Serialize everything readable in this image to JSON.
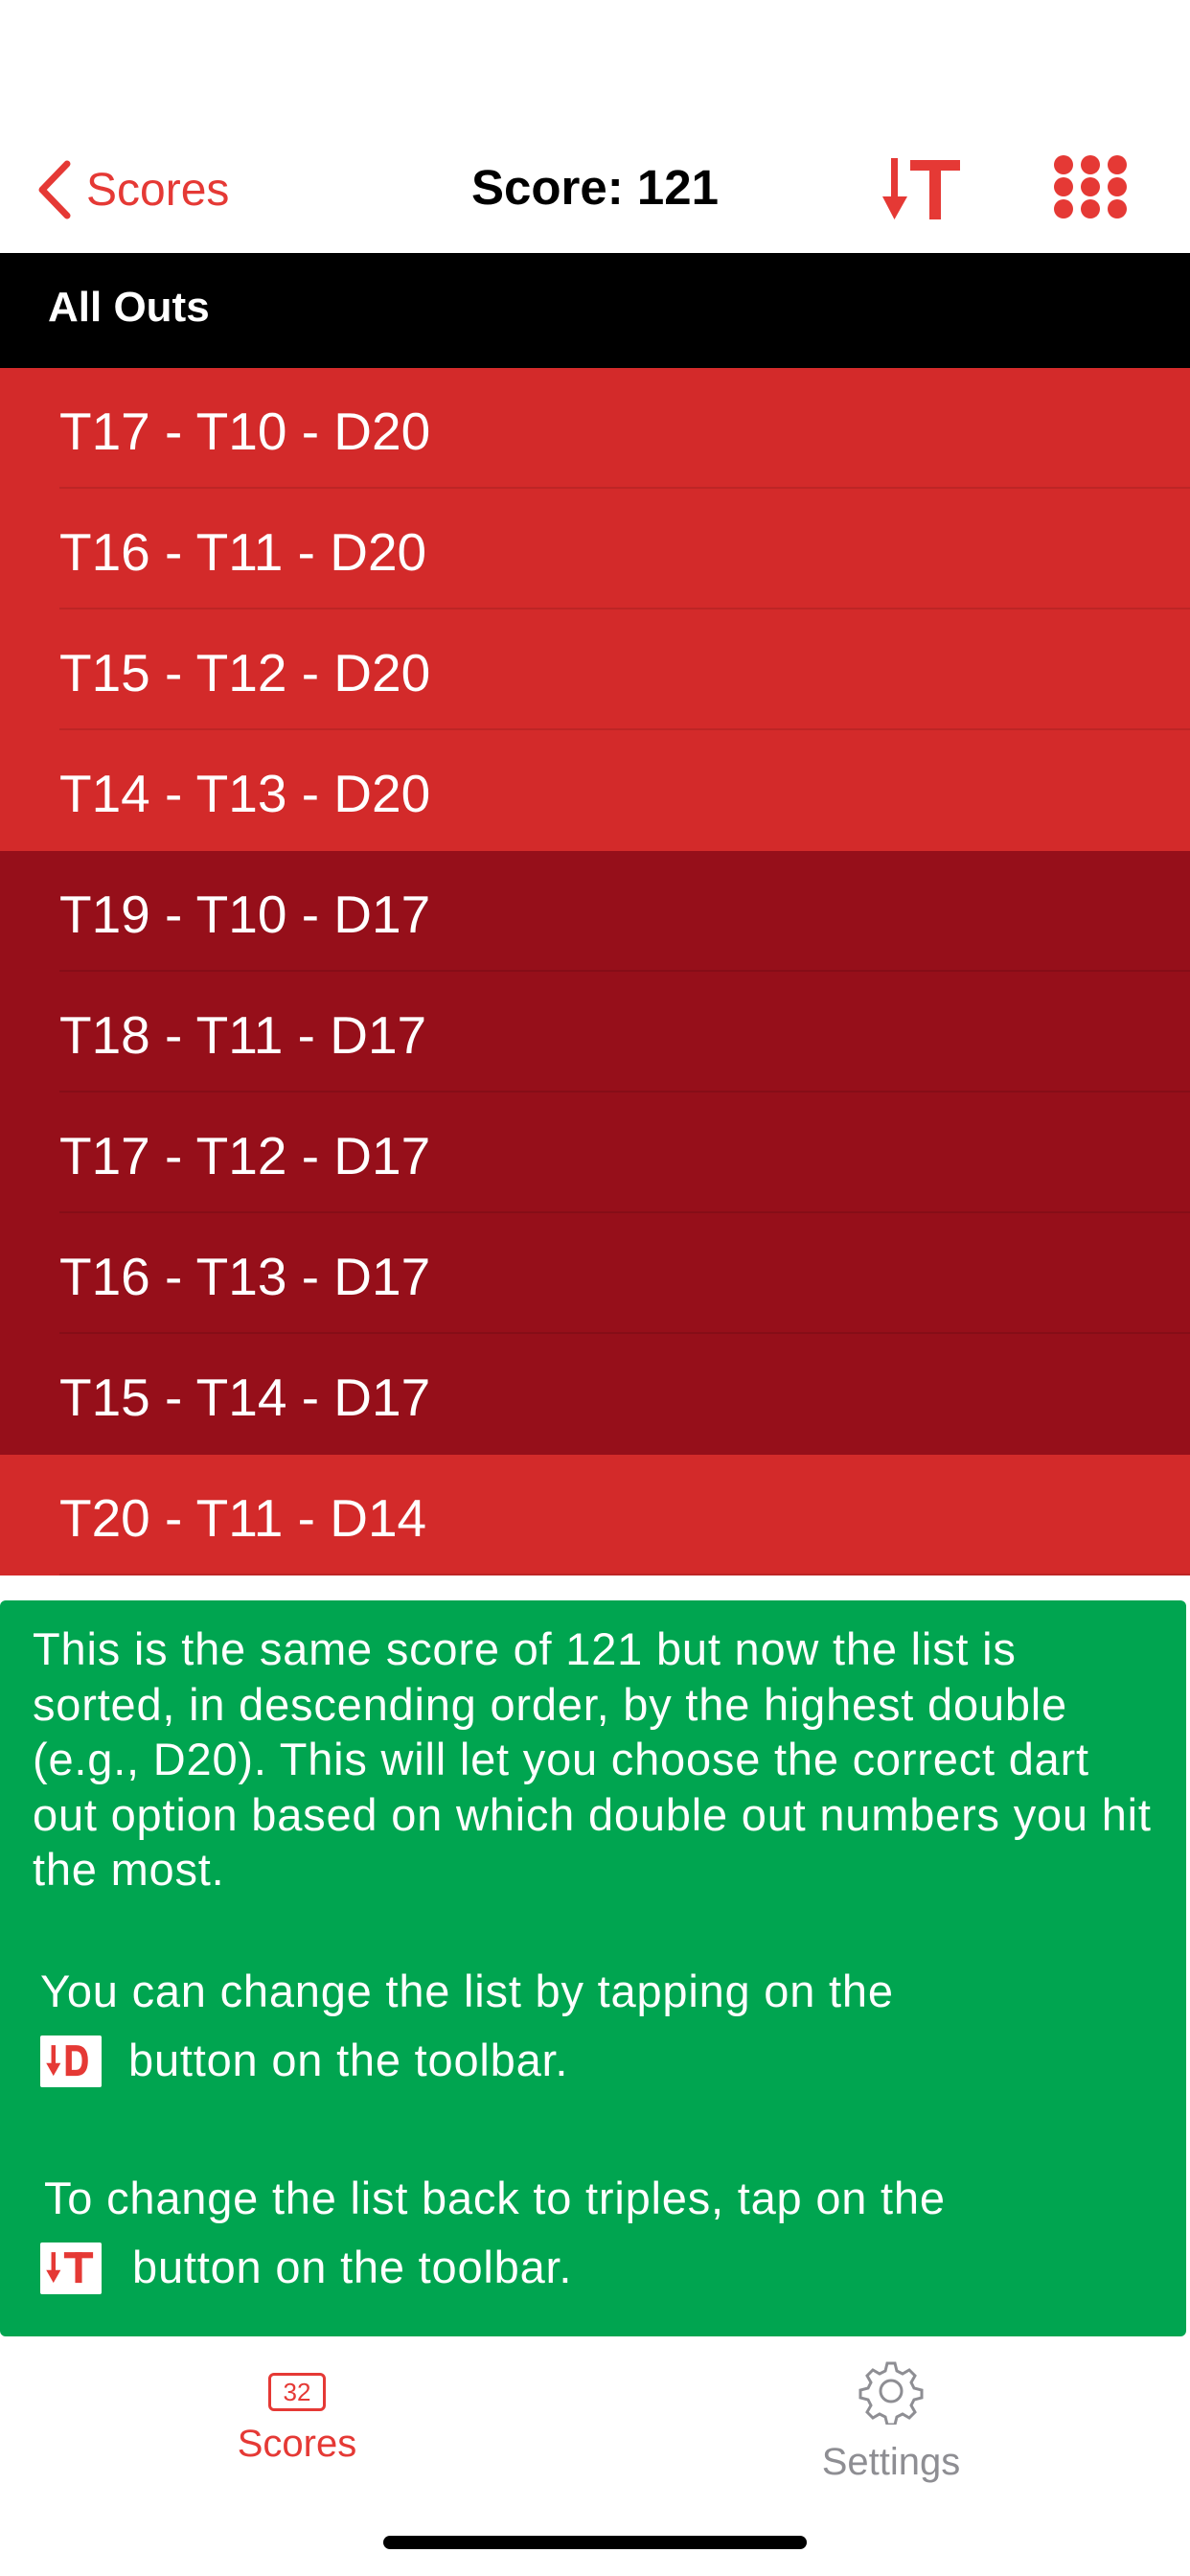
{
  "nav": {
    "back_label": "Scores",
    "title": "Score: 121",
    "sort_icon": "sort-triples-icon",
    "grid_icon": "keypad-grid-icon",
    "accent": "#e53935"
  },
  "section": {
    "header": "All Outs"
  },
  "rows": [
    {
      "label": "T17 - T10 - D20",
      "shade": "light"
    },
    {
      "label": "T16 - T11 - D20",
      "shade": "light"
    },
    {
      "label": "T15 - T12 - D20",
      "shade": "light"
    },
    {
      "label": "T14 - T13 - D20",
      "shade": "light"
    },
    {
      "label": "T19 - T10 - D17",
      "shade": "dark"
    },
    {
      "label": "T18 - T11 - D17",
      "shade": "dark"
    },
    {
      "label": "T17 - T12 - D17",
      "shade": "dark"
    },
    {
      "label": "T16 - T13 - D17",
      "shade": "dark"
    },
    {
      "label": "T15 - T14 - D17",
      "shade": "dark"
    },
    {
      "label": "T20 - T11 - D14",
      "shade": "light"
    }
  ],
  "overlay": {
    "paragraph1": "This is the same score of 121 but now the list is sorted, in descending order, by the highest double (e.g., D20).  This will let you choose the correct dart out option based on which double out numbers you hit the most.",
    "paragraph2_line1": "You can change the list by tapping on the",
    "paragraph2_line2": "button on the toolbar.",
    "paragraph3_line1": "To change the list back to triples, tap on the",
    "paragraph3_line2": "button on the toolbar.",
    "chip_double_icon": "sort-doubles-icon",
    "chip_triple_icon": "sort-triples-icon",
    "background": "#00a550"
  },
  "tabbar": {
    "scores_badge": "32",
    "scores_label": "Scores",
    "settings_label": "Settings"
  },
  "colors": {
    "row_light": "#d32a2a",
    "row_dark": "#960f1a",
    "section_bg": "#000000"
  }
}
